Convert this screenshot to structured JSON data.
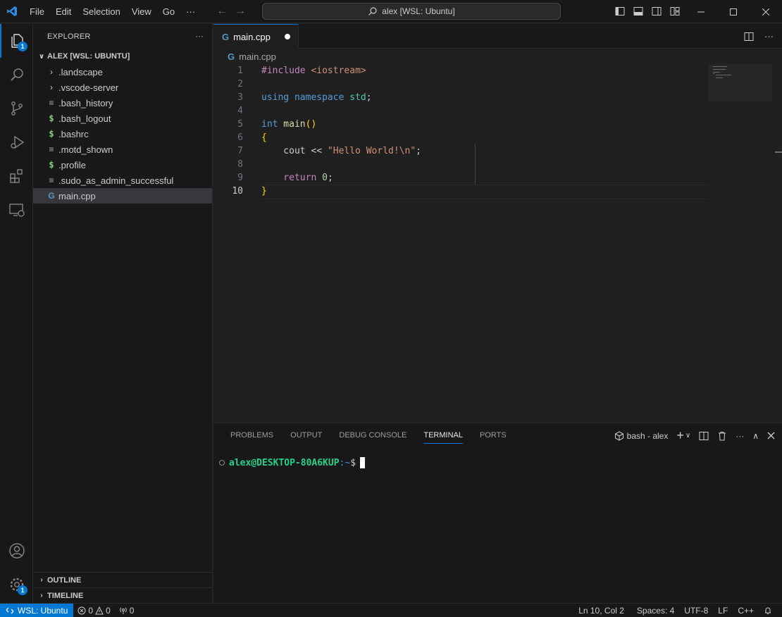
{
  "menu": [
    "File",
    "Edit",
    "Selection",
    "View",
    "Go"
  ],
  "menu_more": "···",
  "command_center": "alex [WSL: Ubuntu]",
  "activity": {
    "explorer_badge": "1",
    "settings_badge": "1"
  },
  "sidebar": {
    "title": "EXPLORER",
    "more": "···",
    "root": "ALEX [WSL: UBUNTU]",
    "items": [
      {
        "label": ".landscape",
        "icon": "folder"
      },
      {
        "label": ".vscode-server",
        "icon": "folder"
      },
      {
        "label": ".bash_history",
        "icon": "file"
      },
      {
        "label": ".bash_logout",
        "icon": "shell"
      },
      {
        "label": ".bashrc",
        "icon": "shell"
      },
      {
        "label": ".motd_shown",
        "icon": "file"
      },
      {
        "label": ".profile",
        "icon": "shell"
      },
      {
        "label": ".sudo_as_admin_successful",
        "icon": "file"
      },
      {
        "label": "main.cpp",
        "icon": "cpp"
      }
    ],
    "outline": "OUTLINE",
    "timeline": "TIMELINE"
  },
  "editor": {
    "tab_label": "main.cpp",
    "breadcrumb": "main.cpp",
    "line_numbers": [
      "1",
      "2",
      "3",
      "4",
      "5",
      "6",
      "7",
      "8",
      "9",
      "10"
    ],
    "code": {
      "l1_include": "#include",
      "l1_header": " <iostream>",
      "l3_using": "using",
      "l3_namespace": " namespace",
      "l3_std": " std",
      "l3_semi": ";",
      "l5_int": "int",
      "l5_main": " main",
      "l5_parens": "()",
      "l6_brace": "{",
      "l7_cout": "    cout << ",
      "l7_str": "\"Hello World!\\n\"",
      "l7_semi": ";",
      "l9_return": "    return",
      "l9_zero": " 0",
      "l9_semi": ";",
      "l10_brace": "}"
    }
  },
  "panel": {
    "tabs": [
      "PROBLEMS",
      "OUTPUT",
      "DEBUG CONSOLE",
      "TERMINAL",
      "PORTS"
    ],
    "active_tab": "TERMINAL",
    "terminal_name": "bash - alex",
    "prompt_user": "alex@DESKTOP-80A6KUP",
    "prompt_path": ":~",
    "prompt_symbol": "$"
  },
  "status": {
    "remote": "WSL: Ubuntu",
    "errors": "0",
    "warnings": "0",
    "ports": "0",
    "position": "Ln 10, Col 2",
    "spaces": "Spaces: 4",
    "encoding": "UTF-8",
    "eol": "LF",
    "language": "C++"
  }
}
